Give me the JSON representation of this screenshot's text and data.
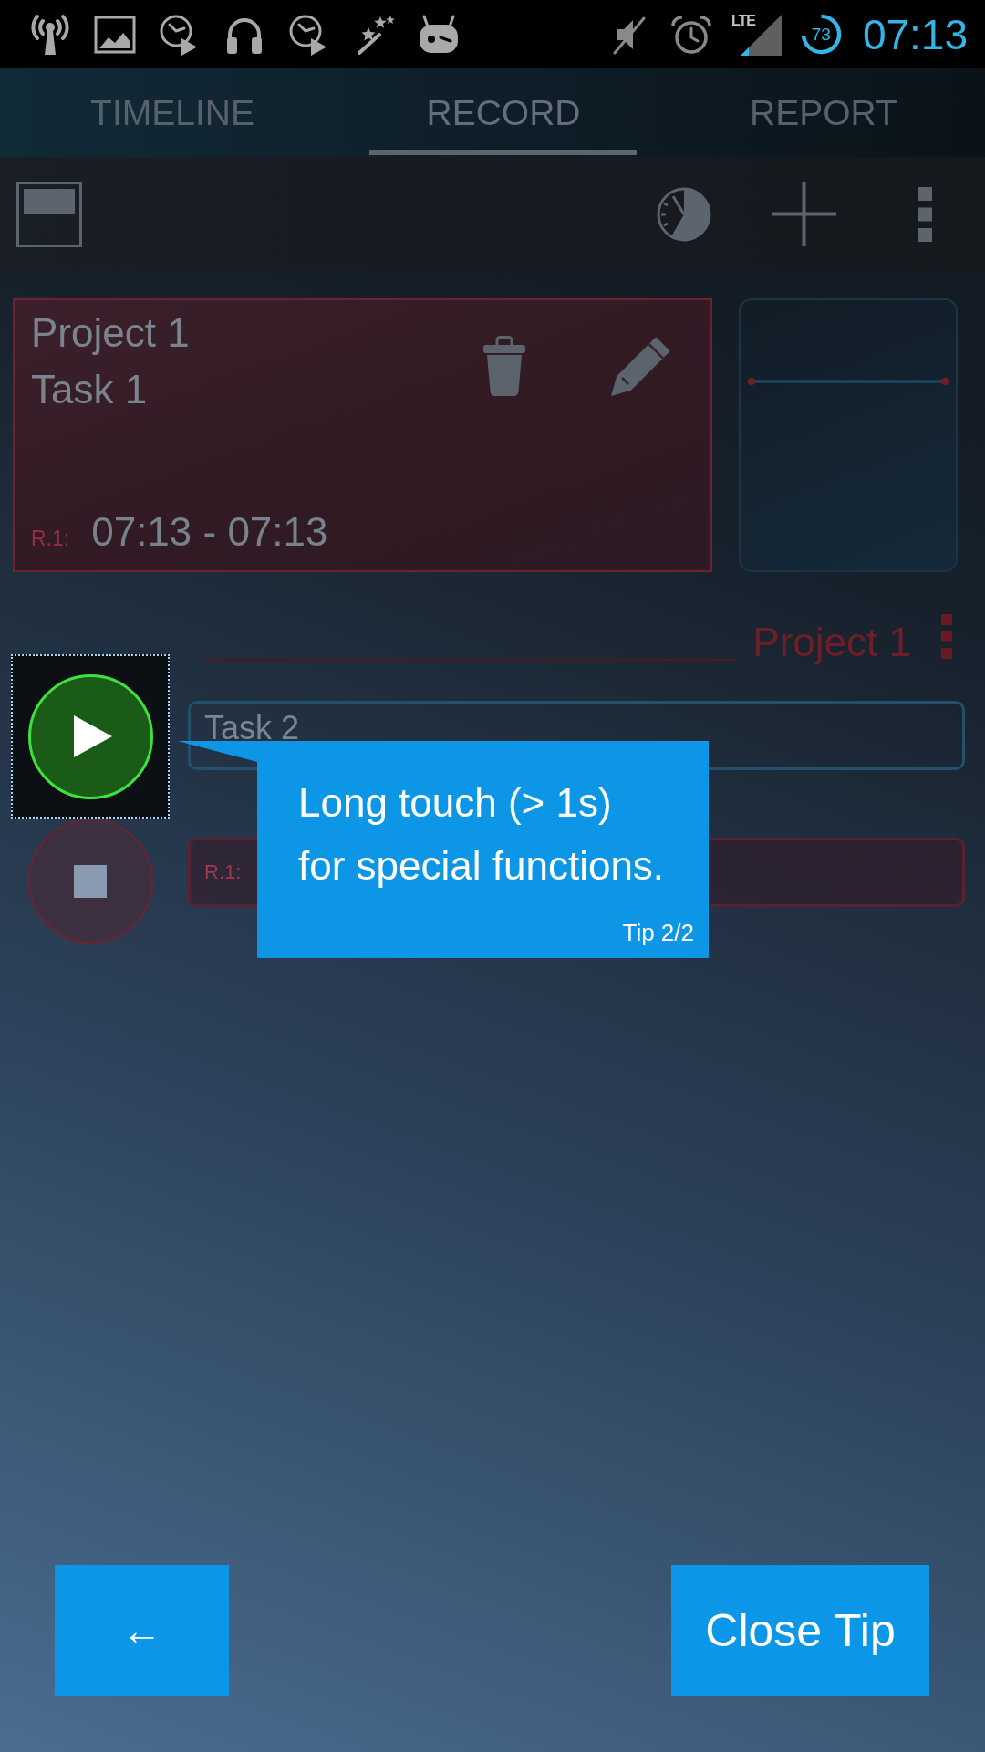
{
  "status_bar": {
    "network_type": "LTE",
    "battery_percent": "73",
    "time": "07:13"
  },
  "tabs": [
    {
      "label": "TIMELINE",
      "selected": false
    },
    {
      "label": "RECORD",
      "selected": true
    },
    {
      "label": "REPORT",
      "selected": false
    }
  ],
  "record_card": {
    "project": "Project 1",
    "task": "Task 1",
    "range_label": "R.1:",
    "time_range": "07:13 - 07:13"
  },
  "project_group": {
    "title": "Project 1",
    "controls": [
      {
        "kind": "play",
        "highlighted": true
      },
      {
        "kind": "stop",
        "highlighted": false
      }
    ],
    "fields": [
      {
        "kind": "task",
        "value": "Task 2"
      },
      {
        "kind": "range",
        "label": "R.1:"
      }
    ]
  },
  "tip": {
    "lines": [
      "Long touch (> 1s)",
      "for special functions."
    ],
    "counter": "Tip 2/2"
  },
  "tip_buttons": [
    {
      "kind": "back",
      "label": "←"
    },
    {
      "kind": "close",
      "label": "Close Tip"
    }
  ]
}
